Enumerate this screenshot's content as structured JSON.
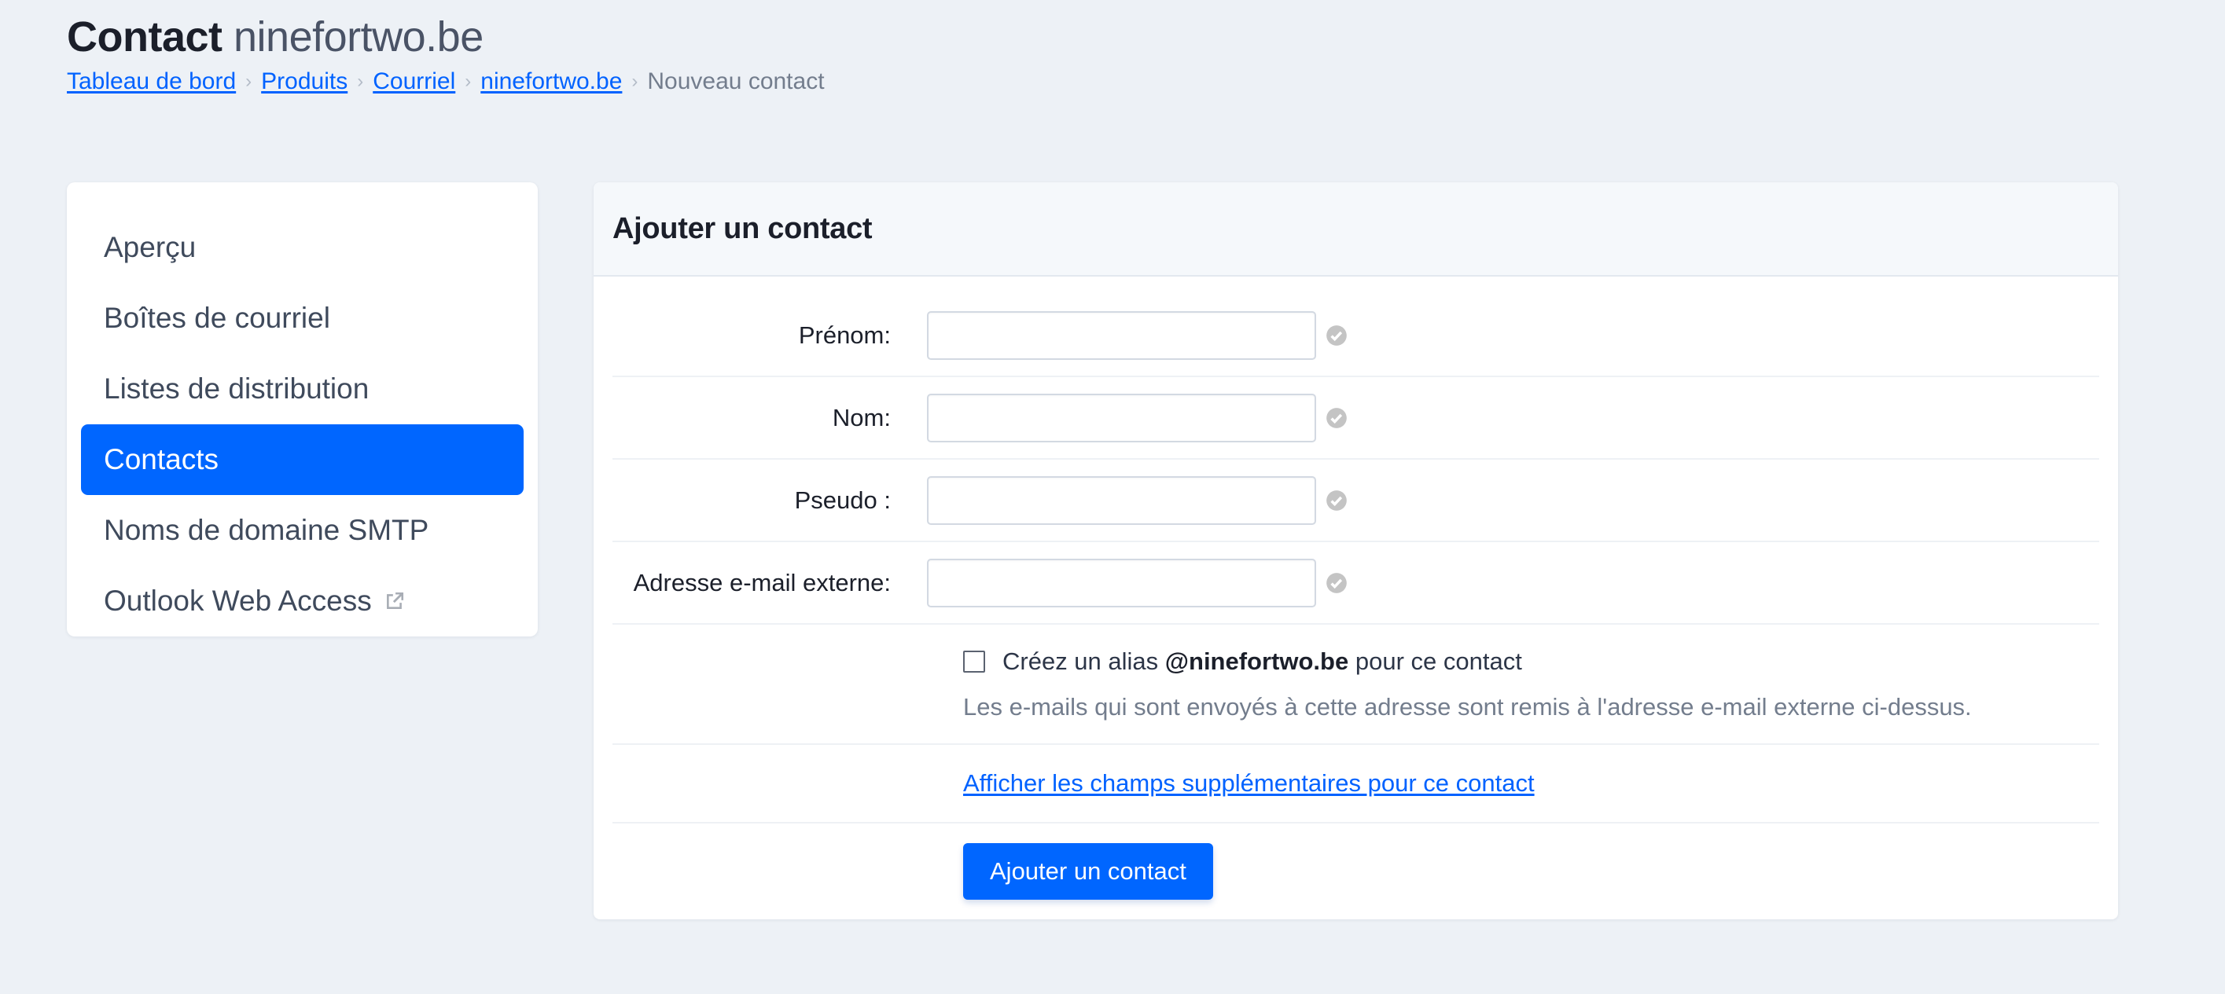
{
  "header": {
    "title_strong": "Contact",
    "title_light": "ninefortwo.be"
  },
  "breadcrumb": {
    "items": [
      "Tableau de bord",
      "Produits",
      "Courriel",
      "ninefortwo.be"
    ],
    "current": "Nouveau contact",
    "separator": "›"
  },
  "sidebar": {
    "items": [
      {
        "label": "Aperçu",
        "active": false
      },
      {
        "label": "Boîtes de courriel",
        "active": false
      },
      {
        "label": "Listes de distribution",
        "active": false
      },
      {
        "label": "Contacts",
        "active": true
      },
      {
        "label": "Noms de domaine SMTP",
        "active": false
      },
      {
        "label": "Outlook Web Access",
        "active": false,
        "icon": "external-link-icon"
      }
    ]
  },
  "form": {
    "title": "Ajouter un contact",
    "fields": [
      {
        "label": "Prénom:",
        "value": "",
        "placeholder": ""
      },
      {
        "label": "Nom:",
        "value": "",
        "placeholder": ""
      },
      {
        "label": "Pseudo :",
        "value": "",
        "placeholder": ""
      },
      {
        "label": "Adresse e-mail externe:",
        "value": "",
        "placeholder": ""
      }
    ],
    "alias": {
      "checked": false,
      "prefix": "Créez un alias",
      "domain": "@ninefortwo.be",
      "suffix": "pour ce contact",
      "help": "Les e-mails qui sont envoyés à cette adresse sont remis à l'adresse e-mail externe ci-dessus."
    },
    "extra_fields_link": "Afficher les champs supplémentaires pour ce contact",
    "submit_label": "Ajouter un contact"
  },
  "colors": {
    "accent": "#0066ff",
    "background": "#edf1f6",
    "valid_icon": "#c4c4c4"
  }
}
